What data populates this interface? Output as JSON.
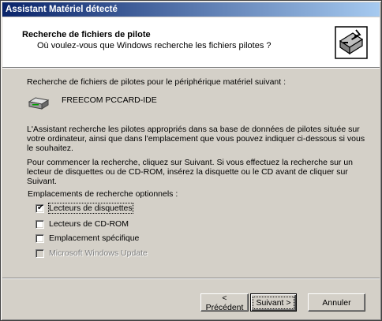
{
  "window": {
    "title": "Assistant Matériel détecté"
  },
  "header": {
    "title": "Recherche de fichiers de pilote",
    "subtitle": "Où voulez-vous que Windows recherche les fichiers pilotes ?",
    "icon": "hardware-wizard-icon"
  },
  "body": {
    "intro": "Recherche de fichiers de pilotes pour le périphérique matériel suivant :",
    "device_icon": "pc-card-icon",
    "device_name": "FREECOM PCCARD-IDE",
    "paragraph1": "L'Assistant recherche les pilotes appropriés dans sa base de données de pilotes située sur votre ordinateur, ainsi que dans l'emplacement que vous pouvez indiquer ci-dessous si vous le souhaitez.",
    "paragraph2": "Pour commencer la recherche, cliquez sur Suivant. Si vous effectuez la recherche sur un lecteur de disquettes ou de CD-ROM, insérez la disquette ou le CD avant de cliquer sur Suivant.",
    "options_label": "Emplacements de recherche optionnels :"
  },
  "options": [
    {
      "label": "Lecteurs de disquettes",
      "checked": true,
      "enabled": true
    },
    {
      "label": "Lecteurs de CD-ROM",
      "checked": false,
      "enabled": true
    },
    {
      "label": "Emplacement spécifique",
      "checked": false,
      "enabled": true
    },
    {
      "label": "Microsoft Windows Update",
      "checked": false,
      "enabled": false
    }
  ],
  "buttons": {
    "back": "< Précédent",
    "next": "Suivant >",
    "cancel": "Annuler"
  },
  "colors": {
    "title_gradient_start": "#0a246a",
    "title_gradient_end": "#a6caf0",
    "face": "#d4d0c8"
  }
}
